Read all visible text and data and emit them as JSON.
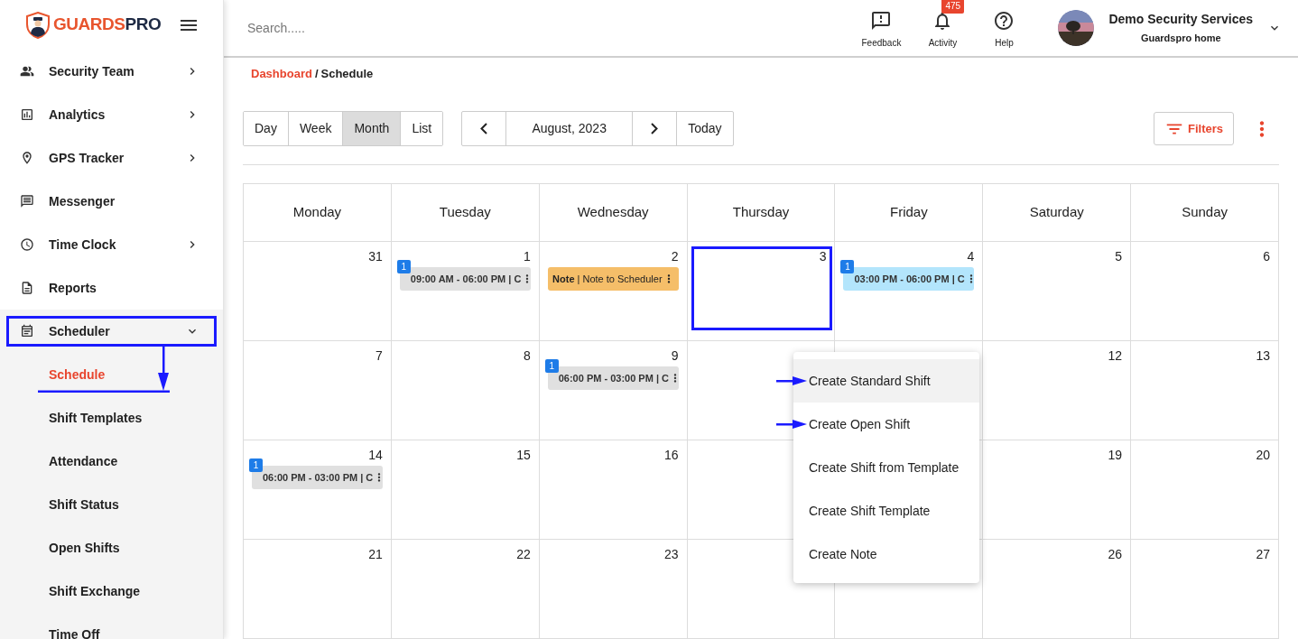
{
  "logo": {
    "brand_first": "GUARDS",
    "brand_second": "PRO"
  },
  "sidebar": {
    "items": [
      {
        "label": "Security Team",
        "has_submenu": true,
        "expanded": false,
        "highlighted": false
      },
      {
        "label": "Analytics",
        "has_submenu": true,
        "expanded": false,
        "highlighted": false
      },
      {
        "label": "GPS Tracker",
        "has_submenu": true,
        "expanded": false,
        "highlighted": false
      },
      {
        "label": "Messenger",
        "has_submenu": false,
        "expanded": false,
        "highlighted": false
      },
      {
        "label": "Time Clock",
        "has_submenu": true,
        "expanded": false,
        "highlighted": false
      },
      {
        "label": "Reports",
        "has_submenu": false,
        "expanded": false,
        "highlighted": false
      },
      {
        "label": "Scheduler",
        "has_submenu": true,
        "expanded": true,
        "highlighted": true,
        "children": [
          {
            "label": "Schedule",
            "selected": true,
            "pointed": true
          },
          {
            "label": "Shift Templates",
            "selected": false,
            "pointed": false
          },
          {
            "label": "Attendance",
            "selected": false,
            "pointed": false
          },
          {
            "label": "Shift Status",
            "selected": false,
            "pointed": false
          },
          {
            "label": "Open Shifts",
            "selected": false,
            "pointed": false
          },
          {
            "label": "Shift Exchange",
            "selected": false,
            "pointed": false
          },
          {
            "label": "Time Off",
            "selected": false,
            "pointed": false
          }
        ]
      }
    ]
  },
  "topbar": {
    "search": {
      "placeholder": "Search....."
    },
    "actions": [
      {
        "label": "Feedback"
      },
      {
        "label": "Activity",
        "badge": "475"
      },
      {
        "label": "Help"
      }
    ],
    "account": {
      "name": "Demo Security Services",
      "subtitle": "Guardspro home"
    }
  },
  "breadcrumb": {
    "link": "Dashboard",
    "separator": "/",
    "current": "Schedule"
  },
  "toolbar": {
    "views": [
      {
        "label": "Day",
        "selected": false
      },
      {
        "label": "Week",
        "selected": false
      },
      {
        "label": "Month",
        "selected": true
      },
      {
        "label": "List",
        "selected": false
      }
    ],
    "period": "August, 2023",
    "today": "Today",
    "filters": "Filters"
  },
  "calendar": {
    "weekdays": [
      "Monday",
      "Tuesday",
      "Wednesday",
      "Thursday",
      "Friday",
      "Saturday",
      "Sunday"
    ],
    "weeks": [
      [
        {
          "kind": "day",
          "day": "31"
        },
        {
          "kind": "day",
          "day": "1",
          "events": [
            {
              "kind": "shift",
              "count": "1",
              "text": "09:00 AM - 06:00 PM | C",
              "color": "#e0e0e0"
            }
          ]
        },
        {
          "kind": "day",
          "day": "2",
          "events": [
            {
              "kind": "note",
              "text": "**Note** | Note to Scheduler",
              "color": "#f5be69"
            }
          ]
        },
        {
          "kind": "day",
          "day": "3",
          "highlighted": true
        },
        {
          "kind": "day",
          "day": "4",
          "events": [
            {
              "kind": "shift",
              "count": "1",
              "text": "03:00 PM - 06:00 PM | C",
              "color": "#b3e5fc"
            }
          ]
        },
        {
          "kind": "day",
          "day": "5"
        },
        {
          "kind": "day",
          "day": "6"
        }
      ],
      [
        {
          "kind": "day",
          "day": "7"
        },
        {
          "kind": "day",
          "day": "8"
        },
        {
          "kind": "day",
          "day": "9",
          "events": [
            {
              "kind": "shift",
              "count": "1",
              "text": "06:00 PM - 03:00 PM | C",
              "color": "#e0e0e0"
            }
          ]
        },
        {
          "kind": "blank"
        },
        {
          "kind": "blank"
        },
        {
          "kind": "day",
          "day": "12"
        },
        {
          "kind": "day",
          "day": "13"
        }
      ],
      [
        {
          "kind": "day",
          "day": "14",
          "events": [
            {
              "kind": "shift",
              "count": "1",
              "text": "06:00 PM - 03:00 PM | C",
              "color": "#e0e0e0"
            }
          ]
        },
        {
          "kind": "day",
          "day": "15"
        },
        {
          "kind": "day",
          "day": "16"
        },
        {
          "kind": "blank"
        },
        {
          "kind": "blank"
        },
        {
          "kind": "day",
          "day": "19"
        },
        {
          "kind": "day",
          "day": "20"
        }
      ],
      [
        {
          "kind": "day",
          "day": "21"
        },
        {
          "kind": "day",
          "day": "22"
        },
        {
          "kind": "day",
          "day": "23"
        },
        {
          "kind": "blank"
        },
        {
          "kind": "blank"
        },
        {
          "kind": "day",
          "day": "26"
        },
        {
          "kind": "day",
          "day": "27"
        }
      ]
    ]
  },
  "context_menu": {
    "items": [
      {
        "label": "Create Standard Shift",
        "highlighted": true,
        "pointed": true
      },
      {
        "label": "Create Open Shift",
        "highlighted": false,
        "pointed": true
      },
      {
        "label": "Create Shift from Template",
        "highlighted": false,
        "pointed": false
      },
      {
        "label": "Create Shift Template",
        "highlighted": false,
        "pointed": false
      },
      {
        "label": "Create Note",
        "highlighted": false,
        "pointed": false
      }
    ]
  }
}
